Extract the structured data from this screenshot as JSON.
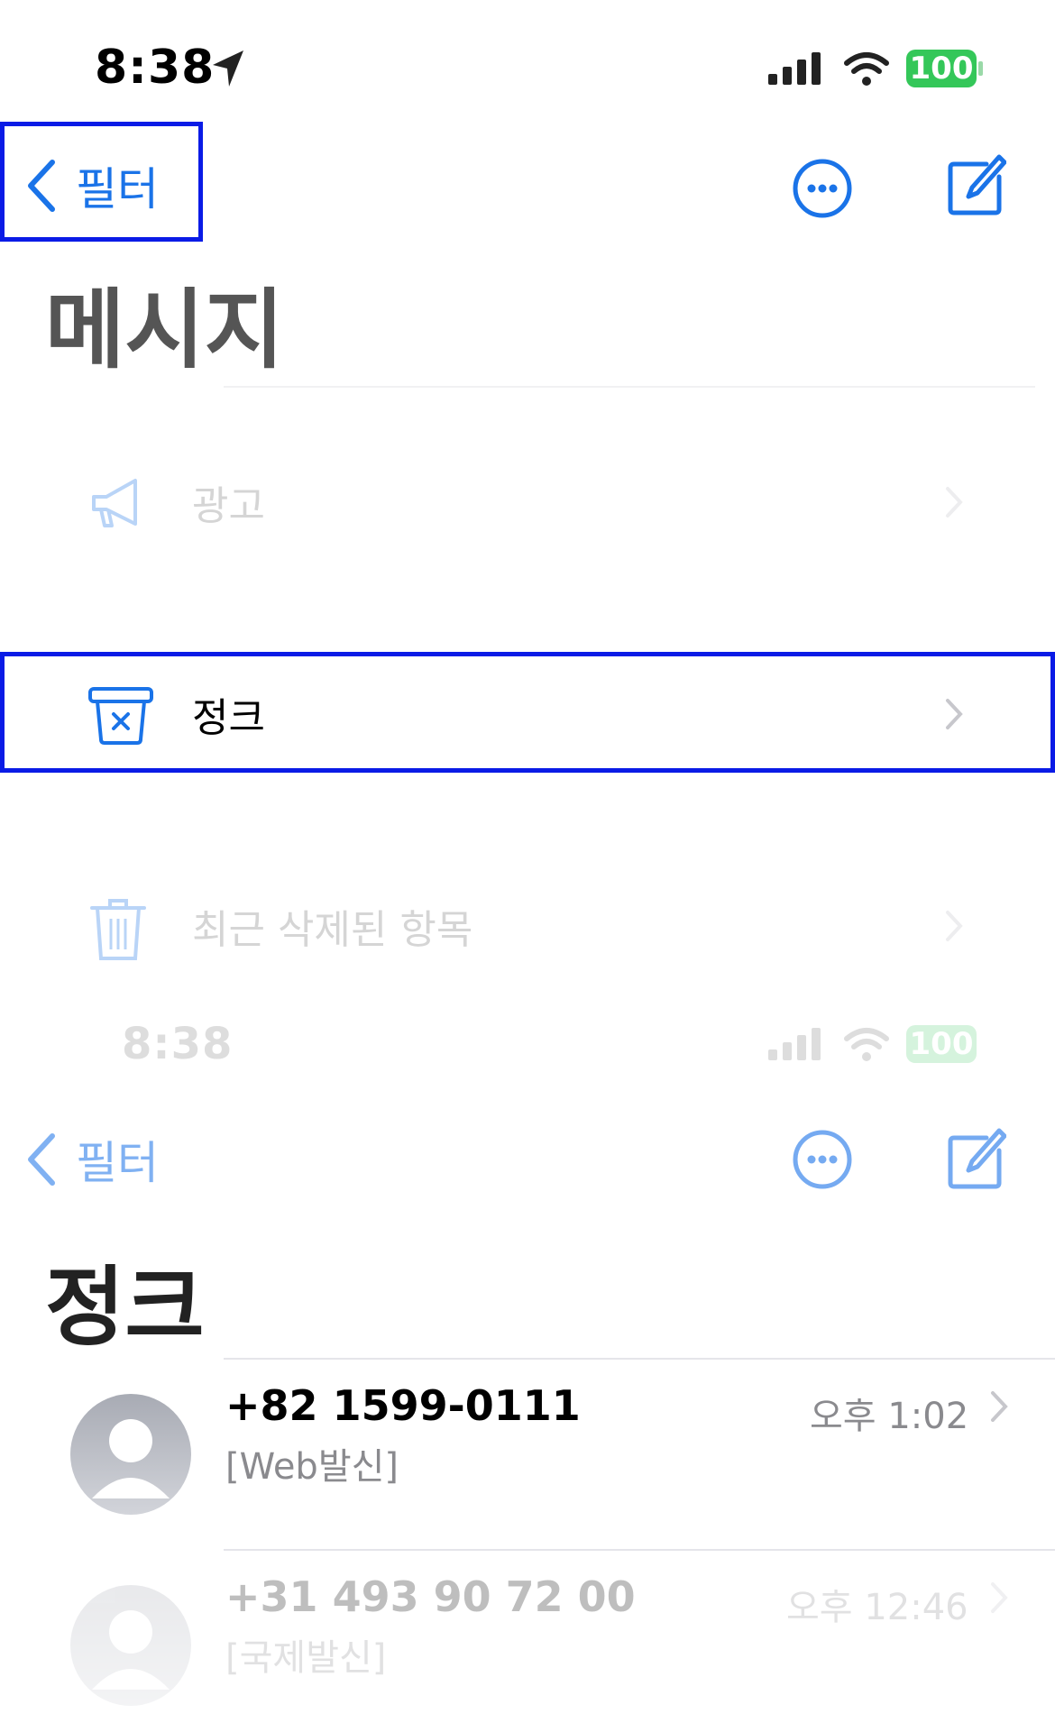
{
  "screen1": {
    "status": {
      "time": "8:38",
      "battery": "100"
    },
    "nav": {
      "back_label": "필터"
    },
    "title": "메시지",
    "items": [
      {
        "label": "광고",
        "icon": "megaphone-icon"
      },
      {
        "label": "정크",
        "icon": "junk-bin-icon"
      },
      {
        "label": "최근 삭제된 항목",
        "icon": "trash-icon"
      }
    ]
  },
  "screen2": {
    "status": {
      "time": "8:38",
      "battery": "100"
    },
    "nav": {
      "back_label": "필터"
    },
    "title": "정크",
    "messages": [
      {
        "sender": "+82 1599-0111",
        "preview": "[Web발신]",
        "time": "오후 1:02"
      },
      {
        "sender": "+31 493 90 72 00",
        "preview": "[국제발신]",
        "time": "오후 12:46"
      }
    ]
  },
  "colors": {
    "accent": "#1a73e8",
    "highlight": "#0a1be6",
    "battery": "#34c759"
  }
}
